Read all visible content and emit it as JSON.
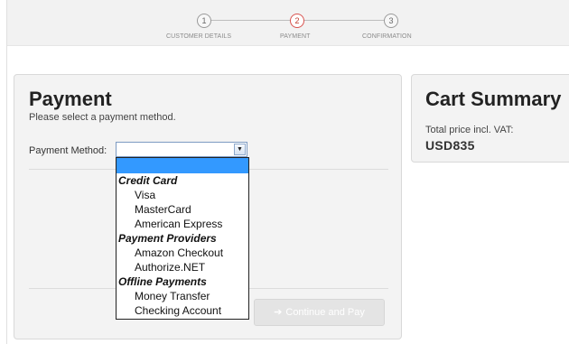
{
  "steps": [
    {
      "number": "1",
      "label": "CUSTOMER DETAILS",
      "active": false
    },
    {
      "number": "2",
      "label": "PAYMENT",
      "active": true
    },
    {
      "number": "3",
      "label": "CONFIRMATION",
      "active": false
    }
  ],
  "payment": {
    "title": "Payment",
    "subtitle": "Please select a payment method.",
    "method_label": "Payment Method:",
    "selected_value": "",
    "continue_label": "Continue and Pay"
  },
  "dropdown": {
    "groups": [
      {
        "name": "Credit Card",
        "items": [
          "Visa",
          "MasterCard",
          "American Express"
        ]
      },
      {
        "name": "Payment Providers",
        "items": [
          "Amazon Checkout",
          "Authorize.NET"
        ]
      },
      {
        "name": "Offline Payments",
        "items": [
          "Money Transfer",
          "Checking Account"
        ]
      }
    ]
  },
  "cart": {
    "title": "Cart Summary",
    "total_label": "Total price incl. VAT:",
    "total_value": "USD835"
  },
  "colors": {
    "active_step": "#d9534f",
    "highlight": "#3399ff"
  }
}
